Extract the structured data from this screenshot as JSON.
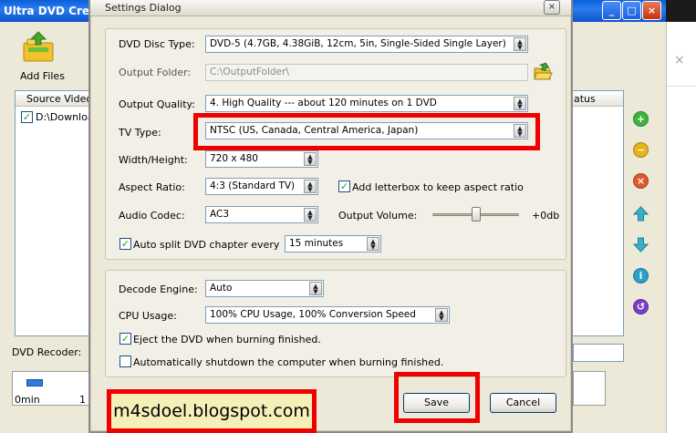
{
  "main_window": {
    "title": "Ultra DVD Cre",
    "add_files_label": "Add Files",
    "list_header_source": "Source Video",
    "list_header_status": "atus",
    "list_item": "D:\\Downloa",
    "dvd_recoder_label": "DVD Recoder:",
    "timeline_label_start": "0min",
    "timeline_label_next": "1"
  },
  "dialog": {
    "title": "Settings Dialog",
    "close_glyph": "×",
    "disc_type": {
      "label": "DVD Disc Type:",
      "value": "DVD-5   (4.7GB, 4.38GiB, 12cm, 5in, Single-Sided Single Layer)"
    },
    "output_folder": {
      "label": "Output Folder:",
      "value": "C:\\OutputFolder\\"
    },
    "output_quality": {
      "label": "Output Quality:",
      "value": "4. High   Quality --- about 120 minutes on 1 DVD"
    },
    "tv_type": {
      "label": "TV Type:",
      "value": "NTSC (US, Canada, Central America, Japan)"
    },
    "width_height": {
      "label": "Width/Height:",
      "value": "720 x 480"
    },
    "aspect_ratio": {
      "label": "Aspect Ratio:",
      "value": "4:3 (Standard TV)"
    },
    "letterbox": {
      "label": "Add letterbox to keep aspect ratio",
      "checked": true
    },
    "audio_codec": {
      "label": "Audio Codec:",
      "value": "AC3"
    },
    "output_volume": {
      "label": "Output Volume:",
      "value": "+0db",
      "level": 0.5
    },
    "auto_split": {
      "label": "Auto split DVD chapter every",
      "checked": true,
      "value": "15 minutes"
    },
    "decode_engine": {
      "label": "Decode Engine:",
      "value": "Auto"
    },
    "cpu_usage": {
      "label": "CPU Usage:",
      "value": "100% CPU Usage, 100% Conversion Speed"
    },
    "eject": {
      "label": "Eject the DVD when burning finished.",
      "checked": true
    },
    "shutdown": {
      "label": "Automatically shutdown the computer when  burning finished.",
      "checked": false
    },
    "save_label": "Save",
    "cancel_label": "Cancel"
  },
  "watermark": "m4sdoel.blogspot.com",
  "colors": {
    "highlight": "#ee0000",
    "titlebar": "#0a5fd8"
  }
}
